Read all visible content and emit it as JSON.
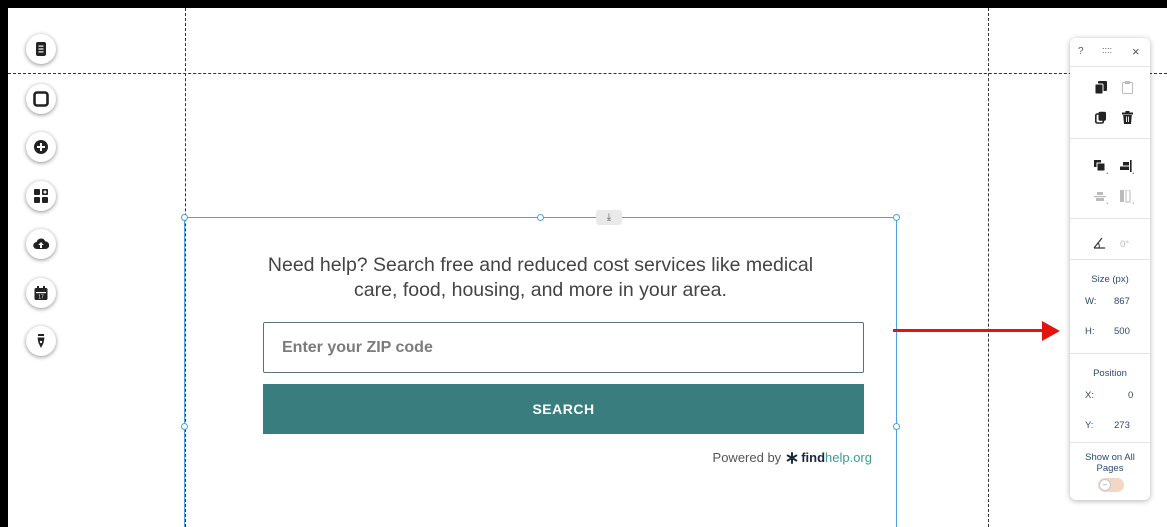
{
  "toolbar": {
    "items": [
      {
        "name": "pages-icon"
      },
      {
        "name": "frame-icon"
      },
      {
        "name": "add-icon"
      },
      {
        "name": "apps-icon"
      },
      {
        "name": "upload-icon"
      },
      {
        "name": "calendar-icon"
      },
      {
        "name": "pen-icon"
      }
    ]
  },
  "widget": {
    "help_line1": "Need help? Search free and reduced cost services like medical",
    "help_line2": "care, food, housing, and more in your area.",
    "zip_placeholder": "Enter your ZIP code",
    "search_label": "SEARCH",
    "powered_by": "Powered by",
    "brand_part1": "find",
    "brand_part2": "help.org",
    "download_glyph": "⤓"
  },
  "panel": {
    "help": "?",
    "drag": "::::",
    "close": "×",
    "angle_value": "0°",
    "size_title": "Size (px)",
    "w_label": "W:",
    "w_value": "867",
    "h_label": "H:",
    "h_value": "500",
    "position_title": "Position",
    "x_label": "X:",
    "x_value": "0",
    "y_label": "Y:",
    "y_value": "273",
    "show_all_line1": "Show on All",
    "show_all_line2": "Pages",
    "toggle_glyph": "–"
  },
  "colors": {
    "accent": "#3a7d7e",
    "selection": "#4aa3df",
    "arrow": "#e3140f"
  }
}
